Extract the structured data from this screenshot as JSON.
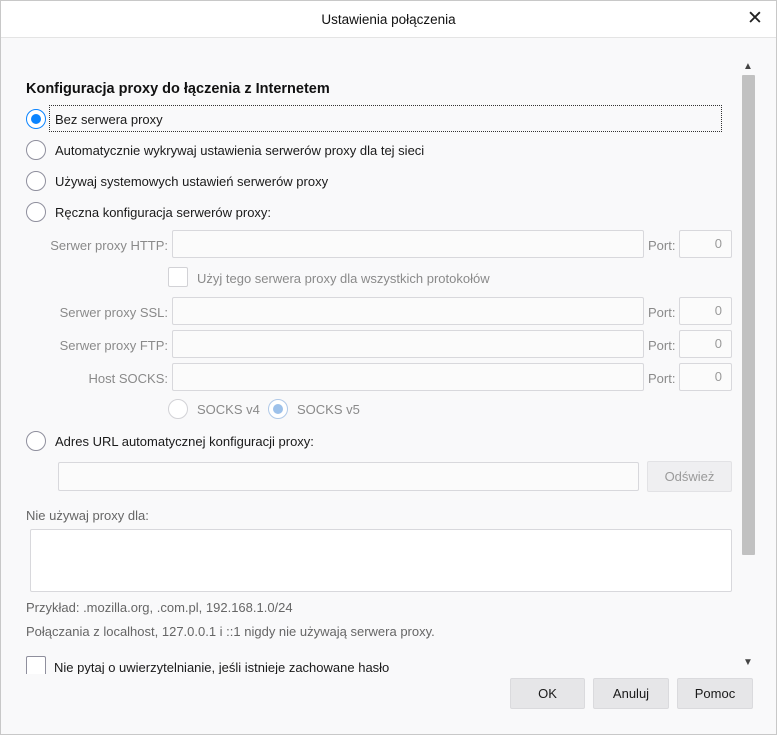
{
  "window": {
    "title": "Ustawienia połączenia",
    "close_glyph": "✕"
  },
  "section_heading": "Konfiguracja proxy do łączenia z Internetem",
  "radios": {
    "no_proxy": {
      "label": "Bez serwera proxy",
      "checked": true
    },
    "auto_detect": {
      "label": "Automatycznie wykrywaj ustawienia serwerów proxy dla tej sieci",
      "checked": false
    },
    "system": {
      "label": "Używaj systemowych ustawień serwerów proxy",
      "checked": false
    },
    "manual": {
      "label": "Ręczna konfiguracja serwerów proxy:",
      "checked": false
    },
    "auto_url": {
      "label": "Adres URL automatycznej konfiguracji proxy:",
      "checked": false
    }
  },
  "manual": {
    "http_label": "Serwer proxy HTTP:",
    "http_value": "",
    "port_label": "Port:",
    "http_port": "0",
    "share_label": "Użyj tego serwera proxy dla wszystkich protokołów",
    "ssl_label": "Serwer proxy SSL:",
    "ssl_value": "",
    "ssl_port": "0",
    "ftp_label": "Serwer proxy FTP:",
    "ftp_value": "",
    "ftp_port": "0",
    "socks_label": "Host SOCKS:",
    "socks_value": "",
    "socks_port": "0",
    "socks_v4": "SOCKS v4",
    "socks_v5": "SOCKS v5",
    "socks_selected": "SOCKS v5"
  },
  "auto_url": {
    "value": "",
    "reload_label": "Odśwież"
  },
  "no_proxy_for": {
    "label": "Nie używaj proxy dla:",
    "value": "",
    "example": "Przykład: .mozilla.org, .com.pl, 192.168.1.0/24",
    "localhost_note": "Połączania z localhost, 127.0.0.1 i ::1 nigdy nie używają serwera proxy."
  },
  "auth_checkbox_label": "Nie pytaj o uwierzytelnianie, jeśli istnieje zachowane hasło",
  "buttons": {
    "ok": "OK",
    "cancel": "Anuluj",
    "help": "Pomoc"
  },
  "colors": {
    "accent": "#0a84ff",
    "disabled_text": "#8a8a8a"
  }
}
